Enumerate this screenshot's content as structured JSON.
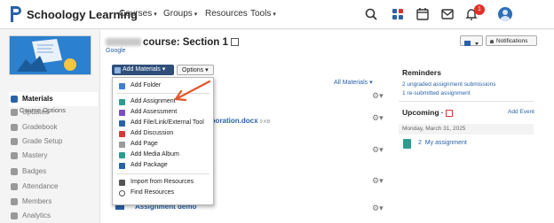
{
  "app": {
    "brand": "Schoology Learning"
  },
  "nav": {
    "courses": "Courses",
    "groups": "Groups",
    "resources": "Resources",
    "tools": "Tools"
  },
  "header_icons": {
    "notifications_count": "1"
  },
  "sidebar": {
    "course_options": "Course Options",
    "items": [
      {
        "label": "Materials",
        "active": true
      },
      {
        "label": "Updates"
      },
      {
        "label": "Gradebook"
      },
      {
        "label": "Grade Setup"
      },
      {
        "label": "Mastery"
      },
      {
        "label": "Badges"
      },
      {
        "label": "Attendance"
      },
      {
        "label": "Members"
      },
      {
        "label": "Analytics"
      }
    ]
  },
  "course": {
    "title": "course: Section 1",
    "subtitle": "Google"
  },
  "toolbar": {
    "add_materials": "Add Materials",
    "options": "Options",
    "notifications": "Notifications"
  },
  "materials": {
    "all_materials": "All Materials",
    "rows": [
      {
        "label": "laboration.docx",
        "size": "9 KB"
      },
      {
        "label": "Assignment demo"
      }
    ]
  },
  "dropdown": {
    "items": [
      "Add Folder",
      "Add Assignment",
      "Add Assessment",
      "Add File/Link/External Tool",
      "Add Discussion",
      "Add Page",
      "Add Media Album",
      "Add Package",
      "Import from Resources",
      "Find Resources"
    ]
  },
  "right_panel": {
    "reminders_title": "Reminders",
    "reminder_1": "2 ungraded assignment submissions",
    "reminder_2": "1 re-submitted assignment",
    "upcoming_title": "Upcoming",
    "add_event": "Add Event",
    "date": "Monday, March 31, 2025",
    "assignment": "My assignment",
    "assignment_count": "2"
  },
  "colors": {
    "accent": "#2a62a8",
    "header_button": "#2f4f7a",
    "arrow": "#e2562b",
    "badge": "#e0302a"
  }
}
